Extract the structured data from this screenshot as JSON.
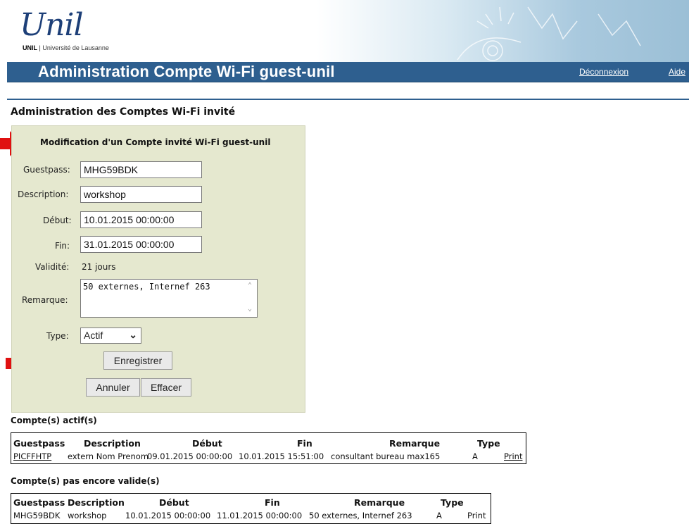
{
  "header": {
    "logo_script": "Unil",
    "logo_org_bold": "UNIL",
    "logo_org_rest": " | Université de Lausanne",
    "app_title": "Administration Compte Wi-Fi guest-unil",
    "logout_link": "Déconnexion",
    "help_link": "Aide"
  },
  "page_title": "Administration des Comptes Wi-Fi invité",
  "form": {
    "title": "Modification d'un Compte invité Wi-Fi guest-unil",
    "guestpass_label": "Guestpass:",
    "guestpass_value": "MHG59BDK",
    "description_label": "Description:",
    "description_value": "workshop",
    "debut_label": "Début:",
    "debut_value": "10.01.2015 00:00:00",
    "fin_label": "Fin:",
    "fin_value": "31.01.2015 00:00:00",
    "validite_label": "Validité:",
    "validite_value": "21 jours",
    "remarque_label": "Remarque:",
    "remarque_value": "50 externes, Internef 263",
    "type_label": "Type:",
    "type_value": "Actif",
    "save_button": "Enregistrer",
    "cancel_button": "Annuler",
    "clear_button": "Effacer"
  },
  "active_accounts": {
    "title": "Compte(s) actif(s)",
    "headers": [
      "Guestpass",
      "Description",
      "Début",
      "Fin",
      "Remarque",
      "Type"
    ],
    "rows": [
      {
        "guestpass": "PICFFHTP",
        "description": "extern Nom Prenom",
        "debut": "09.01.2015 00:00:00",
        "fin": "10.01.2015 15:51:00",
        "remarque": "consultant bureau max165",
        "type": "A",
        "action": "Print"
      }
    ]
  },
  "pending_accounts": {
    "title": "Compte(s) pas encore valide(s)",
    "headers": [
      "Guestpass",
      "Description",
      "Début",
      "Fin",
      "Remarque",
      "Type"
    ],
    "rows": [
      {
        "guestpass": "MHG59BDK",
        "description": "workshop",
        "debut": "10.01.2015 00:00:00",
        "fin": "11.01.2015 00:00:00",
        "remarque": "50 externes, Internef 263",
        "type": "A",
        "action": "Print"
      }
    ]
  },
  "colors": {
    "title_bar": "#2e5f8f",
    "panel_bg": "#e5e8cf",
    "annotation_arrow": "#e01010"
  },
  "icons": [
    "select-caret-icon",
    "scroll-up-icon",
    "scroll-down-icon",
    "annotation-arrow-icon"
  ]
}
